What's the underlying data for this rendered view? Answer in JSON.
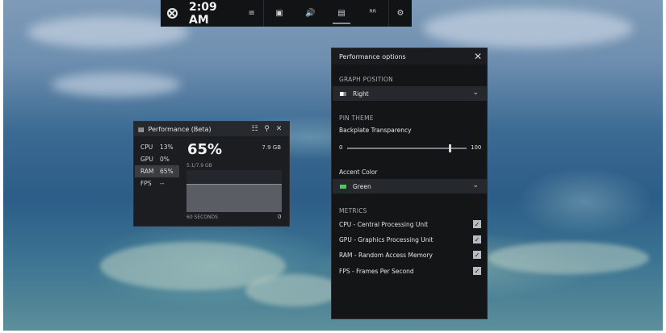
{
  "gamebar": {
    "time": "2:09 AM",
    "logo_icon": "xbox-logo-icon",
    "buttons": [
      {
        "icon": "menu-icon",
        "glyph": "≡"
      },
      {
        "icon": "capture-icon",
        "glyph": "▣"
      },
      {
        "icon": "audio-icon",
        "glyph": "🔊"
      },
      {
        "icon": "performance-icon",
        "glyph": "▤"
      },
      {
        "icon": "social-icon",
        "glyph": "ᴿᴿ"
      },
      {
        "icon": "settings-icon",
        "glyph": "⚙"
      }
    ]
  },
  "perf_widget": {
    "title": "Performance (Beta)",
    "rows": [
      {
        "name": "CPU",
        "value": "13%"
      },
      {
        "name": "GPU",
        "value": "0%"
      },
      {
        "name": "RAM",
        "value": "65%"
      },
      {
        "name": "FPS",
        "value": "--"
      }
    ],
    "selected": "RAM",
    "big_value": "65%",
    "total": "7.9 GB",
    "used": "5.1/7.9 GB",
    "time_label": "60 SECONDS",
    "end_value": "0",
    "graph_fraction": 0.65
  },
  "options": {
    "title": "Performance options",
    "graph_position_heading": "GRAPH POSITION",
    "graph_position_value": "Right",
    "pin_theme_heading": "PIN THEME",
    "transparency_label": "Backplate Transparency",
    "slider_min": "0",
    "slider_max": "100",
    "slider_value": 85,
    "accent_label": "Accent Color",
    "accent_value": "Green",
    "accent_color": "#4ec94e",
    "metrics_heading": "METRICS",
    "metrics": [
      {
        "label": "CPU - Central Processing Unit",
        "checked": true
      },
      {
        "label": "GPU - Graphics Processing Unit",
        "checked": true
      },
      {
        "label": "RAM - Random Access Memory",
        "checked": true
      },
      {
        "label": "FPS - Frames Per Second",
        "checked": true
      }
    ]
  }
}
